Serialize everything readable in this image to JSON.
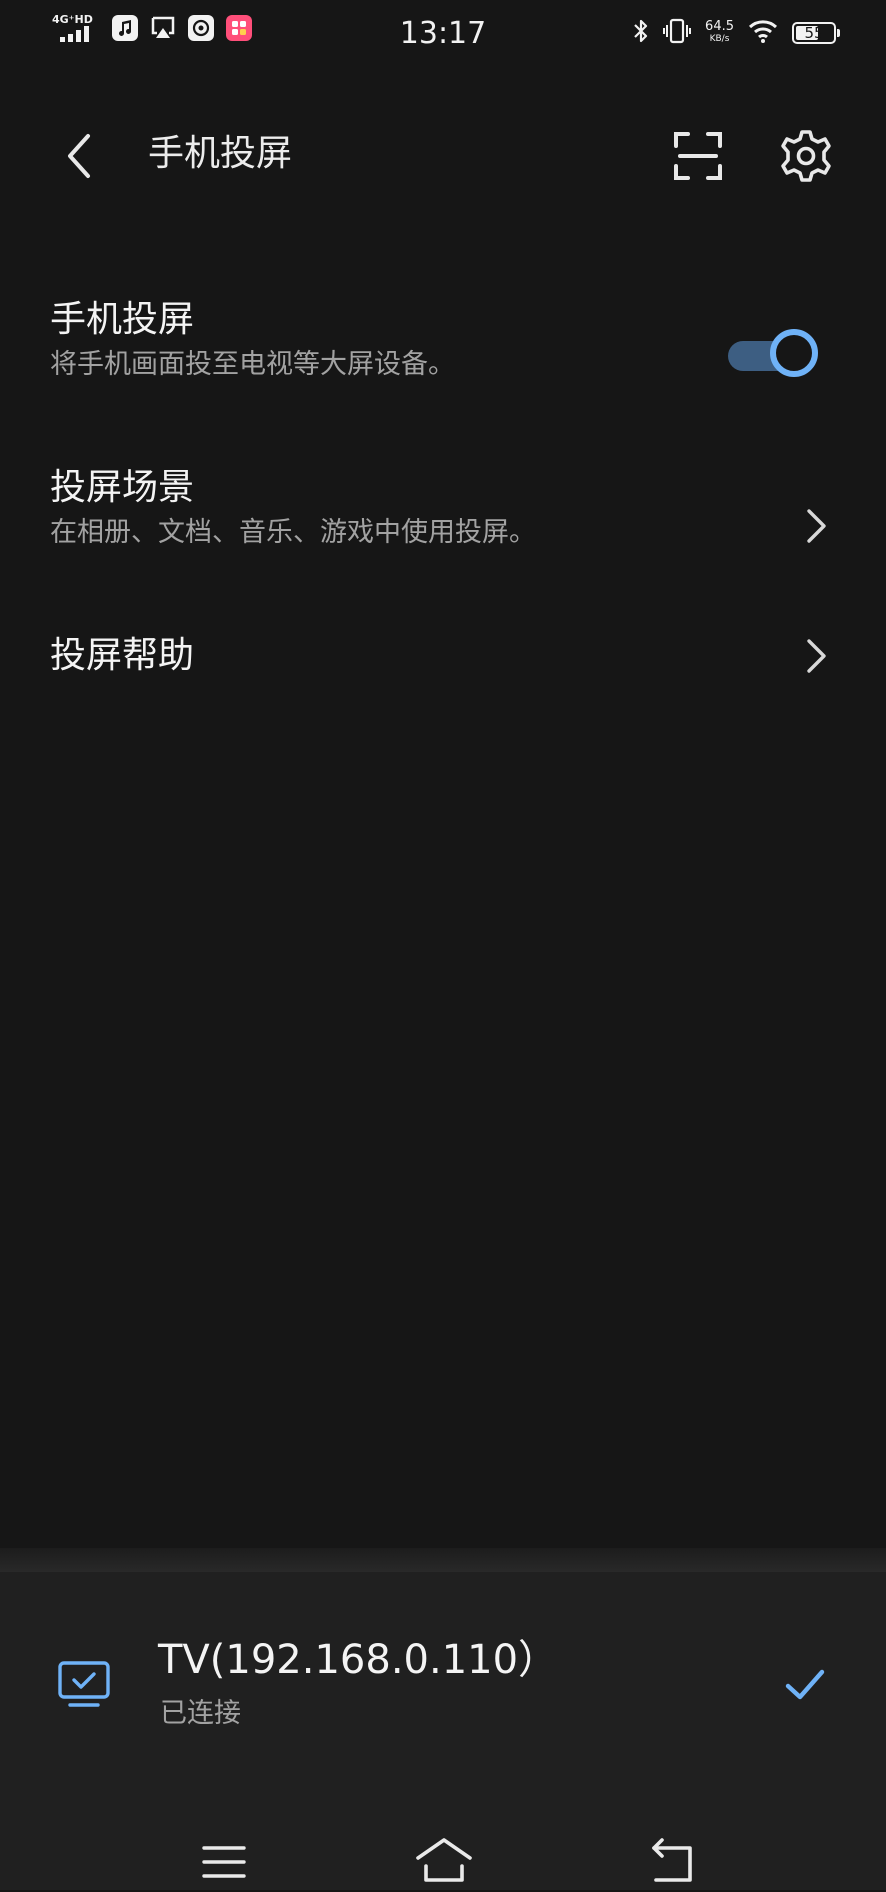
{
  "status_bar": {
    "network_label": "4G⁺HD",
    "time": "13:17",
    "speed_value": "64.5",
    "speed_unit": "KB/s",
    "battery_level": "55",
    "icons": [
      "signal-icon",
      "music-icon",
      "airplay-icon",
      "browser-icon",
      "app-icon",
      "bluetooth-icon",
      "vibrate-icon",
      "wifi-icon",
      "battery-icon"
    ]
  },
  "header": {
    "title": "手机投屏",
    "back_icon": "chevron-left-icon",
    "scan_icon": "scan-icon",
    "settings_icon": "gear-icon"
  },
  "settings": {
    "screen_cast": {
      "title": "手机投屏",
      "subtitle": "将手机画面投至电视等大屏设备。",
      "enabled": true
    },
    "scenes": {
      "title": "投屏场景",
      "subtitle": "在相册、文档、音乐、游戏中使用投屏。"
    },
    "help": {
      "title": "投屏帮助"
    }
  },
  "connected_device": {
    "name": "TV(192.168.0.110）",
    "status": "已连接",
    "icon": "tv-icon",
    "selected": true
  },
  "nav_bar": {
    "icons": [
      "menu-icon",
      "home-icon",
      "back-icon"
    ]
  },
  "colors": {
    "background": "#161616",
    "sheet": "#202020",
    "accent": "#6fb2f7",
    "toggle_track": "#3d5e82",
    "secondary_text": "#a2a2a2"
  }
}
